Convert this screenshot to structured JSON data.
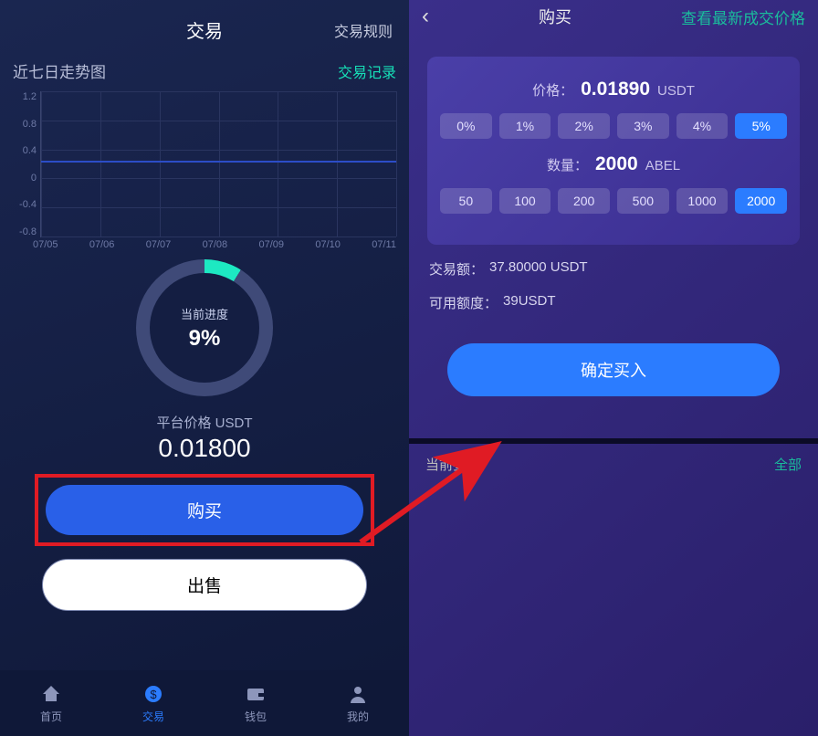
{
  "left": {
    "header": {
      "title": "交易",
      "rules": "交易规则"
    },
    "subheader": {
      "chart_title": "近七日走势图",
      "record": "交易记录"
    },
    "donut": {
      "label": "当前进度",
      "percent_text": "9%",
      "percent_value": 9
    },
    "price": {
      "label": "平台价格 USDT",
      "value": "0.01800"
    },
    "actions": {
      "buy": "购买",
      "sell": "出售"
    },
    "nav": {
      "items": [
        {
          "label": "首页",
          "icon": "home"
        },
        {
          "label": "交易",
          "icon": "trade"
        },
        {
          "label": "钱包",
          "icon": "wallet"
        },
        {
          "label": "我的",
          "icon": "profile"
        }
      ]
    }
  },
  "right": {
    "header": {
      "title": "购买",
      "link": "查看最新成交价格"
    },
    "panel": {
      "price_label": "价格：",
      "price_value": "0.01890",
      "price_unit": "USDT",
      "percent_options": [
        "0%",
        "1%",
        "2%",
        "3%",
        "4%",
        "5%"
      ],
      "percent_selected": "5%",
      "qty_label": "数量：",
      "qty_value": "2000",
      "qty_unit": "ABEL",
      "qty_options": [
        "50",
        "100",
        "200",
        "500",
        "1000",
        "2000"
      ],
      "qty_selected": "2000"
    },
    "info": {
      "amount_label": "交易额：",
      "amount_value": "37.80000 USDT",
      "avail_label": "可用额度：",
      "avail_value": "39USDT"
    },
    "confirm": "确定买入",
    "orders": {
      "title": "当前委托",
      "all": "全部"
    }
  },
  "chart_data": {
    "type": "line",
    "title": "近七日走势图",
    "xlabel": "",
    "ylabel": "",
    "ylim": [
      -0.8,
      1.2
    ],
    "y_ticks": [
      1.2,
      0.8,
      0.4,
      0.0,
      -0.4,
      -0.8
    ],
    "categories": [
      "07/05",
      "07/06",
      "07/07",
      "07/08",
      "07/09",
      "07/10",
      "07/11"
    ],
    "values": [
      0.018,
      0.018,
      0.018,
      0.018,
      0.018,
      0.018,
      0.018
    ]
  }
}
